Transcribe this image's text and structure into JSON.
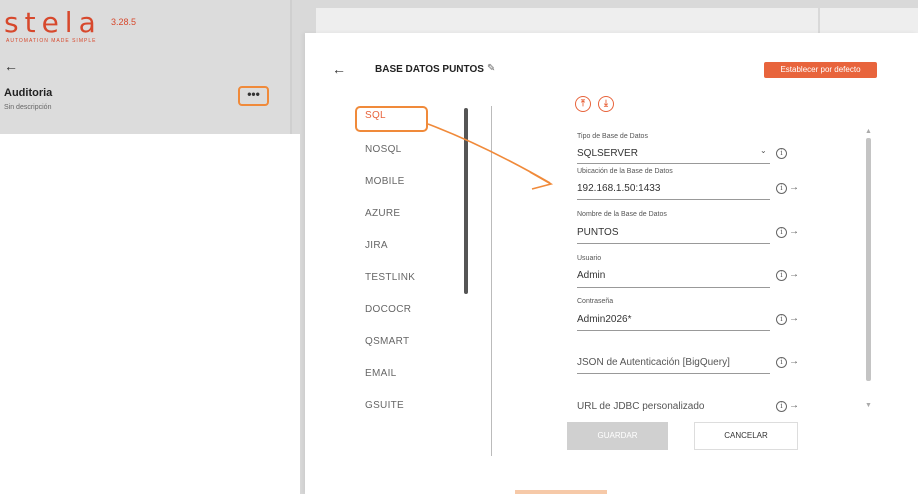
{
  "app": {
    "logo_text": "stela",
    "version": "3.28.5",
    "tagline": "AUTOMATION MADE SIMPLE",
    "back_glyph": "←",
    "project_title": "Auditoria",
    "project_description": "Sin descripción",
    "more_glyph": "•••"
  },
  "modal": {
    "back_glyph": "←",
    "title": "BASE DATOS PUNTOS",
    "edit_glyph": "✎",
    "default_button": "Establecer por defecto",
    "upload_glyph": "⤒",
    "download_glyph": "⤓",
    "categories": [
      "SQL",
      "NOSQL",
      "MOBILE",
      "AZURE",
      "JIRA",
      "TESTLINK",
      "DOCOCR",
      "QSMART",
      "EMAIL",
      "GSUITE"
    ],
    "active_category": "SQL",
    "fields": [
      {
        "label": "Tipo de Base de Datos",
        "value": "SQLSERVER",
        "type": "select"
      },
      {
        "label": "Ubicación de la Base de Datos",
        "value": "192.168.1.50:1433",
        "type": "text"
      },
      {
        "label": "Nombre de la Base de Datos",
        "value": "PUNTOS",
        "type": "text"
      },
      {
        "label": "Usuario",
        "value": "Admin",
        "type": "text"
      },
      {
        "label": "Contraseña",
        "value": "Admin2026*",
        "type": "text"
      },
      {
        "label": "",
        "value": "",
        "placeholder": "JSON de Autenticación [BigQuery]",
        "type": "text"
      },
      {
        "label": "",
        "value": "",
        "placeholder": "URL de JDBC personalizado",
        "type": "text"
      }
    ],
    "info_glyph": "i",
    "arrow_glyph": "→",
    "chevron_glyph": "⌄",
    "save_button": "GUARDAR",
    "cancel_button": "CANCELAR"
  },
  "colors": {
    "accent": "#e8643c",
    "annotation": "#f08a3a"
  },
  "icons": {
    "back": "arrow-left-icon",
    "more": "more-options-icon",
    "edit": "pencil-icon",
    "upload": "upload-icon",
    "download": "download-icon",
    "info": "info-icon",
    "go": "arrow-right-icon",
    "dropdown": "chevron-down-icon"
  }
}
